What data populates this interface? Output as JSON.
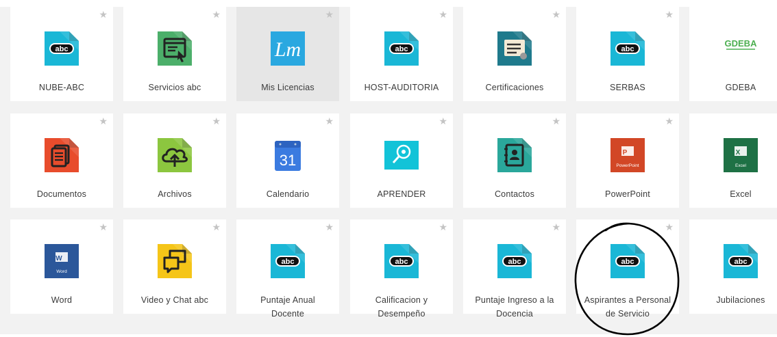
{
  "tiles": [
    {
      "label": "NUBE-ABC",
      "icon": "abc-icon"
    },
    {
      "label": "Servicios abc",
      "icon": "services-window-icon"
    },
    {
      "label": "Mis Licencias",
      "icon": "lm-licenses-icon"
    },
    {
      "label": "HOST-AUDITORIA",
      "icon": "abc-icon"
    },
    {
      "label": "Certificaciones",
      "icon": "certificate-icon"
    },
    {
      "label": "SERBAS",
      "icon": "abc-icon"
    },
    {
      "label": "GDEBA",
      "icon": "gdeba-logo",
      "logo_text": "GDEBA"
    },
    {
      "label": "Documentos",
      "icon": "documents-icon"
    },
    {
      "label": "Archivos",
      "icon": "cloud-upload-icon"
    },
    {
      "label": "Calendario",
      "icon": "calendar-icon",
      "calendar_day": "31"
    },
    {
      "label": "APRENDER",
      "icon": "aprender-icon"
    },
    {
      "label": "Contactos",
      "icon": "contacts-icon"
    },
    {
      "label": "PowerPoint",
      "icon": "powerpoint-icon",
      "app_caption": "PowerPoint"
    },
    {
      "label": "Excel",
      "icon": "excel-icon",
      "app_caption": "Excel"
    },
    {
      "label": "Word",
      "icon": "word-icon",
      "app_caption": "Word"
    },
    {
      "label": "Video y Chat abc",
      "icon": "chat-bubbles-icon"
    },
    {
      "label": "Puntaje Anual\nDocente",
      "icon": "abc-icon"
    },
    {
      "label": "Calificacion y\nDesempeño",
      "icon": "abc-icon"
    },
    {
      "label": "Puntaje Ingreso a la\nDocencia",
      "icon": "abc-icon"
    },
    {
      "label": "Aspirantes a Personal\nde Servicio",
      "icon": "abc-icon"
    },
    {
      "label": "Jubilaciones",
      "icon": "abc-icon"
    }
  ],
  "abc_text": "abc",
  "lm_text": "Lm",
  "star_glyph": "★",
  "colors": {
    "abc_teal": "#1ab7d6",
    "services_green": "#4caf6a",
    "lm_blue": "#2aa8e0",
    "cert_teal": "#1f7a8c",
    "documents_red": "#e84c2c",
    "archivos_lime": "#8cc63f",
    "calendar_blue": "#3b7be0",
    "contacts_teal": "#2aa79b",
    "powerpoint_red": "#d24726",
    "excel_green": "#1e7145",
    "word_blue": "#2b579a",
    "chat_yellow": "#f5c518",
    "gdeba_green": "#4caf50"
  }
}
